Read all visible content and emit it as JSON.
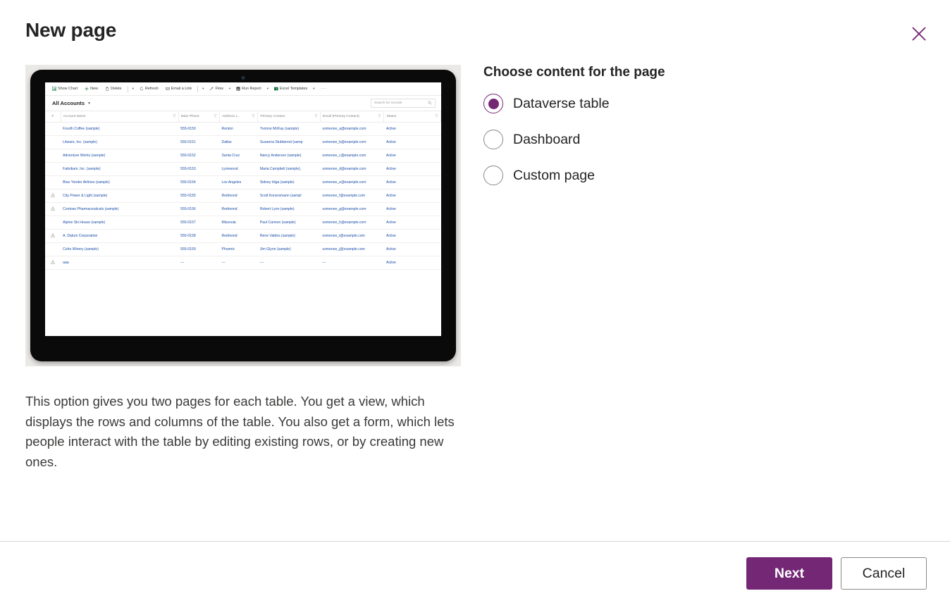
{
  "dialog": {
    "title": "New page",
    "close_label": "Close"
  },
  "content_chooser": {
    "heading": "Choose content for the page",
    "options": [
      {
        "label": "Dataverse table",
        "selected": true
      },
      {
        "label": "Dashboard",
        "selected": false
      },
      {
        "label": "Custom page",
        "selected": false
      }
    ]
  },
  "description": "This option gives you two pages for each table. You get a view, which displays the rows and columns of the table. You also get a form, which lets people interact with the table by editing existing rows, or by creating new ones.",
  "preview": {
    "toolbar": [
      {
        "icon": "chart-icon",
        "label": "Show Chart"
      },
      {
        "icon": "plus-icon",
        "label": "New"
      },
      {
        "icon": "trash-icon",
        "label": "Delete"
      },
      {
        "icon": "chevron-down-icon",
        "label": ""
      },
      {
        "icon": "refresh-icon",
        "label": "Refresh"
      },
      {
        "icon": "mail-icon",
        "label": "Email a Link"
      },
      {
        "icon": "chevron-down-icon",
        "label": ""
      },
      {
        "icon": "flow-icon",
        "label": "Flow"
      },
      {
        "icon": "chevron-down-icon",
        "label": ""
      },
      {
        "icon": "report-icon",
        "label": "Run Report"
      },
      {
        "icon": "chevron-down-icon",
        "label": ""
      },
      {
        "icon": "excel-icon",
        "label": "Excel Templates"
      },
      {
        "icon": "chevron-down-icon",
        "label": ""
      },
      {
        "icon": "overflow-icon",
        "label": "···"
      }
    ],
    "view_name": "All Accounts",
    "search_placeholder": "Search for records",
    "columns": [
      "Account Name",
      "Main Phone",
      "Address 1...",
      "Primary Contact",
      "Email (Primary Contact)",
      "Status"
    ],
    "rows": [
      {
        "warn": false,
        "name": "Fourth Coffee (sample)",
        "phone": "555-0150",
        "city": "Renton",
        "contact": "Yvonne McKay (sample)",
        "email": "someone_a@example.com",
        "status": "Active"
      },
      {
        "warn": false,
        "name": "Litware, Inc. (sample)",
        "phone": "555-0151",
        "city": "Dallas",
        "contact": "Susanna Stubberod (samp",
        "email": "someone_b@example.com",
        "status": "Active"
      },
      {
        "warn": false,
        "name": "Adventure Works (sample)",
        "phone": "555-0152",
        "city": "Santa Cruz",
        "contact": "Nancy Anderson (sample)",
        "email": "someone_c@example.com",
        "status": "Active"
      },
      {
        "warn": false,
        "name": "Fabrikam, Inc. (sample)",
        "phone": "555-0153",
        "city": "Lynnwood",
        "contact": "Maria Campbell (sample),",
        "email": "someone_d@example.com",
        "status": "Active"
      },
      {
        "warn": false,
        "name": "Blue Yonder Airlines (sample)",
        "phone": "555-0154",
        "city": "Los Angeles",
        "contact": "Sidney Higa (sample)",
        "email": "someone_e@example.com",
        "status": "Active"
      },
      {
        "warn": true,
        "name": "City Power & Light (sample)",
        "phone": "555-0155",
        "city": "Redmond",
        "contact": "Scott Konersmann (sampl",
        "email": "someone_f@example.com",
        "status": "Active"
      },
      {
        "warn": true,
        "name": "Contoso Pharmaceuticals (sample)",
        "phone": "555-0156",
        "city": "Redmond",
        "contact": "Robert Lyon (sample)",
        "email": "someone_g@example.com",
        "status": "Active"
      },
      {
        "warn": false,
        "name": "Alpine Ski House (sample)",
        "phone": "555-0157",
        "city": "Missoula",
        "contact": "Paul Cannon (sample)",
        "email": "someone_h@example.com",
        "status": "Active"
      },
      {
        "warn": true,
        "name": "A. Datum Corporation",
        "phone": "555-0158",
        "city": "Redmond",
        "contact": "Rene Valdes (sample)",
        "email": "someone_i@example.com",
        "status": "Active"
      },
      {
        "warn": false,
        "name": "Coho Winery (sample)",
        "phone": "555-0159",
        "city": "Phoenix",
        "contact": "Jim Glynn (sample)",
        "email": "someone_j@example.com",
        "status": "Active"
      },
      {
        "warn": true,
        "name": "aaa",
        "phone": "---",
        "city": "---",
        "contact": "---",
        "email": "---",
        "status": "Active"
      }
    ]
  },
  "footer": {
    "next_label": "Next",
    "cancel_label": "Cancel"
  },
  "colors": {
    "accent": "#742774",
    "preview_bg": "#ebe9e7",
    "link": "#1b4ea8"
  }
}
